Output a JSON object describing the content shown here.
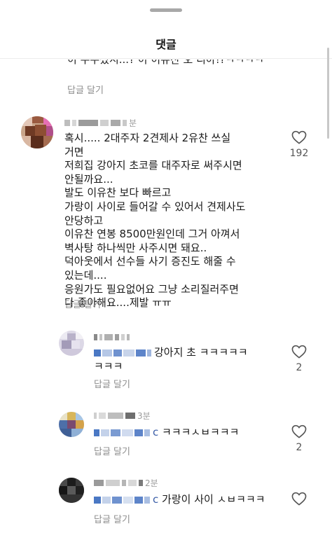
{
  "sheet": {
    "title": "댓글"
  },
  "previous_comment": {
    "cut_text": "이 주주셨시...? 이 이유찬 오 디아!?ㅋㅋㅋㅋ",
    "reply_label": "답글 달기"
  },
  "comments": [
    {
      "time": "분",
      "lines": [
        "혹시..... 2대주자 2견제사 2유찬 쓰실",
        "거면",
        "저희집 강아지 초코를 대주자로 써주시면",
        "안될까요...",
        "발도 이유찬 보다 빠르고",
        "가랑이 사이로 들어갈 수 있어서 견제사도",
        "안당하고",
        "이유찬 연봉 8500만원인데 그거 아껴서",
        "벽사탕 하나씩만 사주시면 돼요..",
        "덕아웃에서 선수들 사기 증진도 해줄 수",
        "있는데....",
        "응원가도 필요없어요 그냥 소리질러주면",
        "다 좋아해요....제발 ㅠㅠ"
      ],
      "reply_label": "답글 달기",
      "likes": "192"
    }
  ],
  "replies": [
    {
      "time": "",
      "mention_suffix": "c",
      "lines": [
        "강아지 초   ㅋㅋㅋㅋㅋ",
        "ㅋㅋㅋ"
      ],
      "reply_label": "답글 달기",
      "likes": "2"
    },
    {
      "time": "3분",
      "mention_suffix": "c",
      "lines": [
        "ㅋㅋㅋㅅㅂㅋㅋㅋ"
      ],
      "reply_label": "답글 달기",
      "likes": "2"
    },
    {
      "time": "2분",
      "mention_suffix": "c",
      "lines": [
        "가랑이 사이 ㅅㅂㅋㅋㅋ"
      ],
      "reply_label": "답글 달기",
      "likes": ""
    }
  ]
}
